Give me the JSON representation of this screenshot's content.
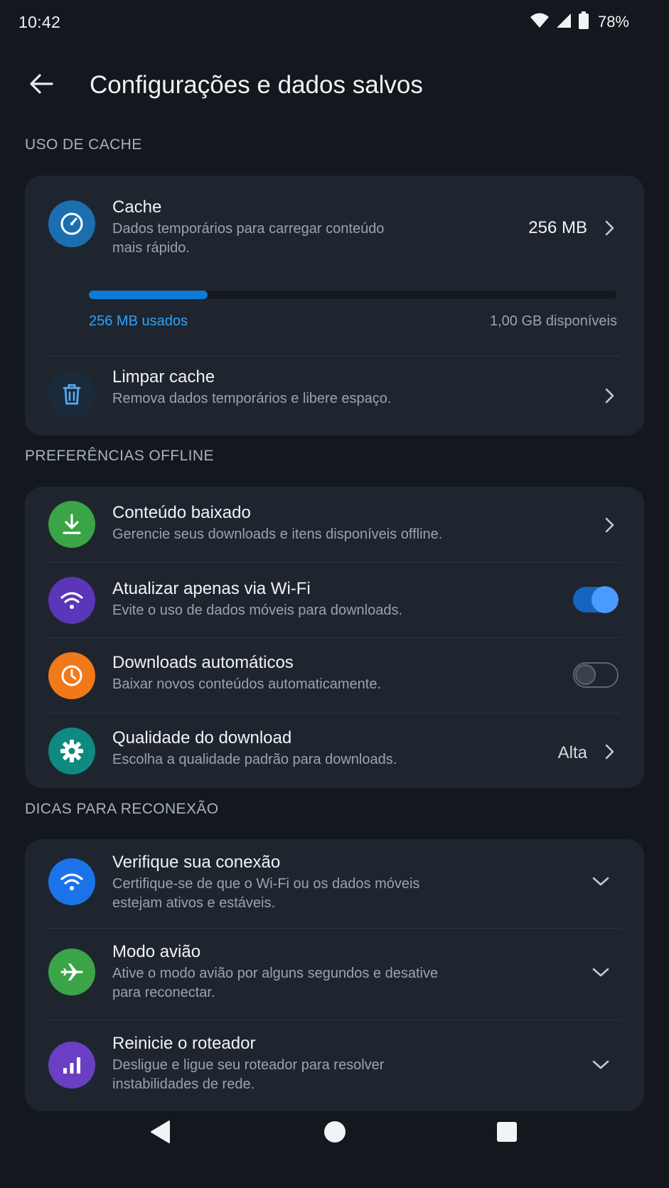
{
  "status": {
    "time": "10:42",
    "battery": "78%"
  },
  "header": {
    "title": "Configurações e dados salvos"
  },
  "cache_section": {
    "label": "USO DE CACHE",
    "cache": {
      "title": "Cache",
      "subtitle_line1": "Dados temporários para carregar conteúdo",
      "subtitle_line2": "mais rápido.",
      "value": "256 MB",
      "used_label": "256 MB usados",
      "available_label": "1,00 GB disponíveis",
      "usage_fraction": 0.25
    },
    "clear": {
      "title": "Limpar cache",
      "subtitle": "Remova dados temporários e libere espaço."
    }
  },
  "offline_section": {
    "label": "PREFERÊNCIAS OFFLINE",
    "items": [
      {
        "title": "Conteúdo baixado",
        "subtitle": "Gerencie seus downloads e itens disponíveis offline."
      },
      {
        "title": "Atualizar apenas via Wi-Fi",
        "subtitle": "Evite o uso de dados móveis para downloads.",
        "toggle_on": true
      },
      {
        "title": "Downloads automáticos",
        "subtitle": "Baixar novos conteúdos automaticamente.",
        "toggle_on": false
      },
      {
        "title": "Qualidade do download",
        "subtitle": "Escolha a qualidade padrão para downloads.",
        "value": "Alta"
      }
    ]
  },
  "tips_section": {
    "label": "DICAS PARA RECONEXÃO",
    "items": [
      {
        "title": "Verifique sua conexão",
        "subtitle_line1": "Certifique-se de que o Wi-Fi ou os dados móveis",
        "subtitle_line2": "estejam ativos e estáveis."
      },
      {
        "title": "Modo avião",
        "subtitle_line1": "Ative o modo avião por alguns segundos e desative",
        "subtitle_line2": "para reconectar."
      },
      {
        "title": "Reinicie o roteador",
        "subtitle_line1": "Desligue e ligue seu roteador para resolver",
        "subtitle_line2": "instabilidades de rede."
      }
    ]
  },
  "colors": {
    "background": "#13171e",
    "card": "#1f252e",
    "accent_blue": "#2ea3ff",
    "icon_cache": "#1b6fb0",
    "icon_clear": "#1b2a3a",
    "icon_download": "#3aa447",
    "icon_wifi": "#5b36b8",
    "icon_auto": "#f07a1a",
    "icon_quality": "#0f8a80",
    "icon_conn": "#1a73e8",
    "icon_plane": "#3aa447",
    "icon_router": "#6a3fc4"
  },
  "icons": [
    "back-arrow-icon",
    "wifi-icon",
    "signal-icon",
    "battery-icon",
    "gauge-icon",
    "trash-icon",
    "download-icon",
    "wifi-icon",
    "clock-icon",
    "gear-icon",
    "airplane-icon",
    "bar-chart-icon",
    "chevron-right-icon",
    "chevron-down-icon",
    "nav-back-icon",
    "nav-home-icon",
    "nav-recents-icon"
  ]
}
